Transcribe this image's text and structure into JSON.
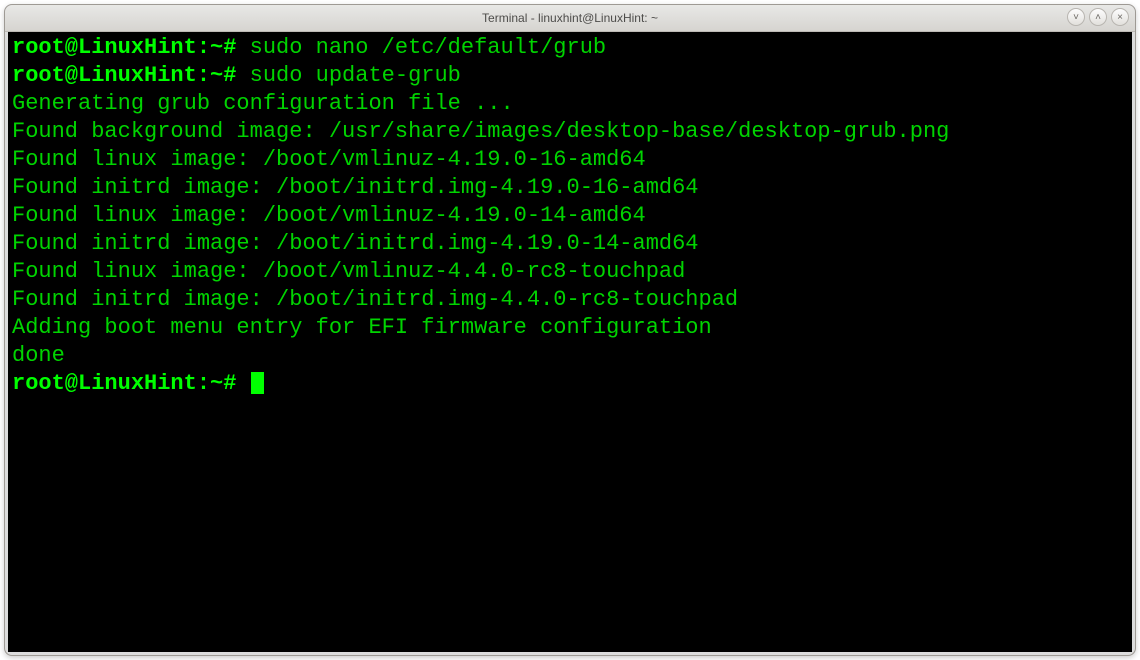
{
  "window": {
    "title": "Terminal - linuxhint@LinuxHint: ~",
    "buttons": {
      "minimize_glyph": "˅",
      "maximize_glyph": "˄",
      "close_glyph": "×"
    }
  },
  "terminal": {
    "prompt": "root@LinuxHint:~# ",
    "cmd1": "sudo nano /etc/default/grub",
    "cmd2": "sudo update-grub",
    "out1": "Generating grub configuration file ...",
    "out2": "Found background image: /usr/share/images/desktop-base/desktop-grub.png",
    "out3": "Found linux image: /boot/vmlinuz-4.19.0-16-amd64",
    "out4": "Found initrd image: /boot/initrd.img-4.19.0-16-amd64",
    "out5": "Found linux image: /boot/vmlinuz-4.19.0-14-amd64",
    "out6": "Found initrd image: /boot/initrd.img-4.19.0-14-amd64",
    "out7": "Found linux image: /boot/vmlinuz-4.4.0-rc8-touchpad",
    "out8": "Found initrd image: /boot/initrd.img-4.4.0-rc8-touchpad",
    "out9": "Adding boot menu entry for EFI firmware configuration",
    "out10": "done"
  }
}
